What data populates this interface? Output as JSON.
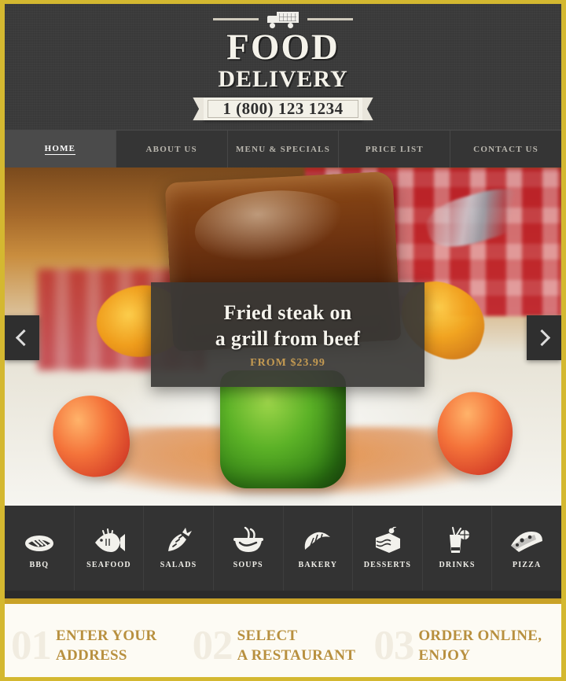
{
  "brand": {
    "truck_icon": "delivery-truck-icon",
    "line1": "FOOD",
    "line2": "DELIVERY",
    "phone": "1 (800) 123 1234"
  },
  "nav": {
    "items": [
      {
        "label": "HOME",
        "active": true
      },
      {
        "label": "ABOUT US",
        "active": false
      },
      {
        "label": "MENU & SPECIALS",
        "active": false
      },
      {
        "label": "PRICE LIST",
        "active": false
      },
      {
        "label": "CONTACT US",
        "active": false
      }
    ]
  },
  "hero": {
    "caption_line1": "Fried steak on",
    "caption_line2": "a grill from beef",
    "price": "FROM $23.99",
    "prev_icon": "chevron-left-icon",
    "next_icon": "chevron-right-icon"
  },
  "categories": [
    {
      "label": "BBQ",
      "icon": "steak-icon"
    },
    {
      "label": "SEAFOOD",
      "icon": "fish-icon"
    },
    {
      "label": "SALADS",
      "icon": "carrot-icon"
    },
    {
      "label": "SOUPS",
      "icon": "soup-bowl-icon"
    },
    {
      "label": "BAKERY",
      "icon": "croissant-icon"
    },
    {
      "label": "DESSERTS",
      "icon": "cake-slice-icon"
    },
    {
      "label": "DRINKS",
      "icon": "cocktail-glass-icon"
    },
    {
      "label": "PIZZA",
      "icon": "pizza-slice-icon"
    }
  ],
  "steps": [
    {
      "num": "01",
      "line1": "ENTER YOUR",
      "line2": "ADDRESS"
    },
    {
      "num": "02",
      "line1": "SELECT",
      "line2": "A RESTAURANT"
    },
    {
      "num": "03",
      "line1": "ORDER ONLINE,",
      "line2": "ENJOY"
    }
  ],
  "colors": {
    "border_gold": "#d4b830",
    "accent_gold": "#c49a52",
    "step_text": "#b8903f",
    "dark": "#3a3a3a",
    "cream": "#fdfbf4"
  }
}
